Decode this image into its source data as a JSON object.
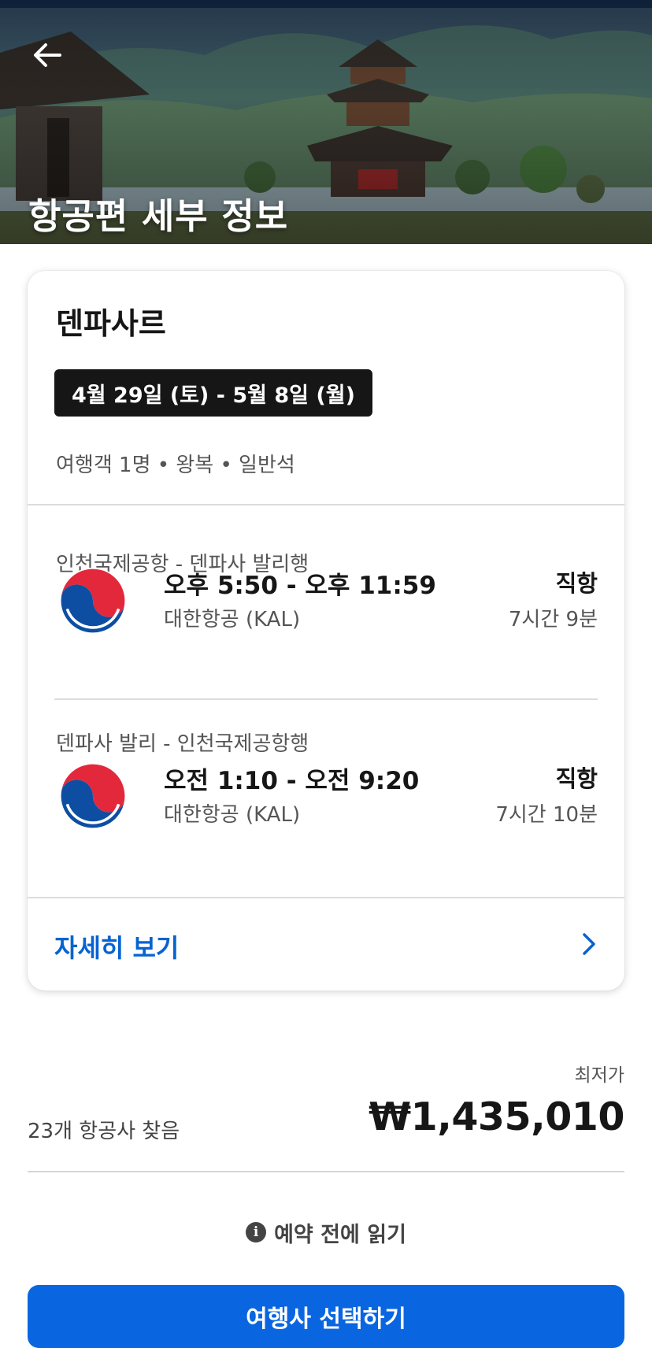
{
  "header": {
    "title": "항공편 세부 정보",
    "back_icon": "arrow-left-icon"
  },
  "summary": {
    "destination": "덴파사르",
    "dates": "4월 29일 (토) - 5월 8일 (월)",
    "trip_info": "여행객 1명  •  왕복  •  일반석"
  },
  "flights": [
    {
      "route": "인천국제공항 - 덴파사 발리행",
      "times": "오후 5:50 - 오후 11:59",
      "airline": "대한항공 (KAL)",
      "stops": "직항",
      "duration": "7시간 9분",
      "logo_icon": "korean-air-taegeuk-icon"
    },
    {
      "route": "덴파사 발리 - 인천국제공항행",
      "times": "오전 1:10 - 오전 9:20",
      "airline": "대한항공 (KAL)",
      "stops": "직항",
      "duration": "7시간 10분",
      "logo_icon": "korean-air-taegeuk-icon"
    }
  ],
  "details_link": {
    "label": "자세히 보기",
    "icon": "chevron-right-icon"
  },
  "pricing": {
    "caption": "최저가",
    "airlines_found": "23개 항공사 찾음",
    "price": "₩1,435,010"
  },
  "read_before": {
    "label": "예약 전에 읽기",
    "icon": "info-icon"
  },
  "cta": {
    "label": "여행사 선택하기"
  },
  "colors": {
    "accent": "#0663d1",
    "button": "#0a66e0",
    "chip": "#161616",
    "logo_red": "#e4283c",
    "logo_blue": "#0d4ea2"
  }
}
